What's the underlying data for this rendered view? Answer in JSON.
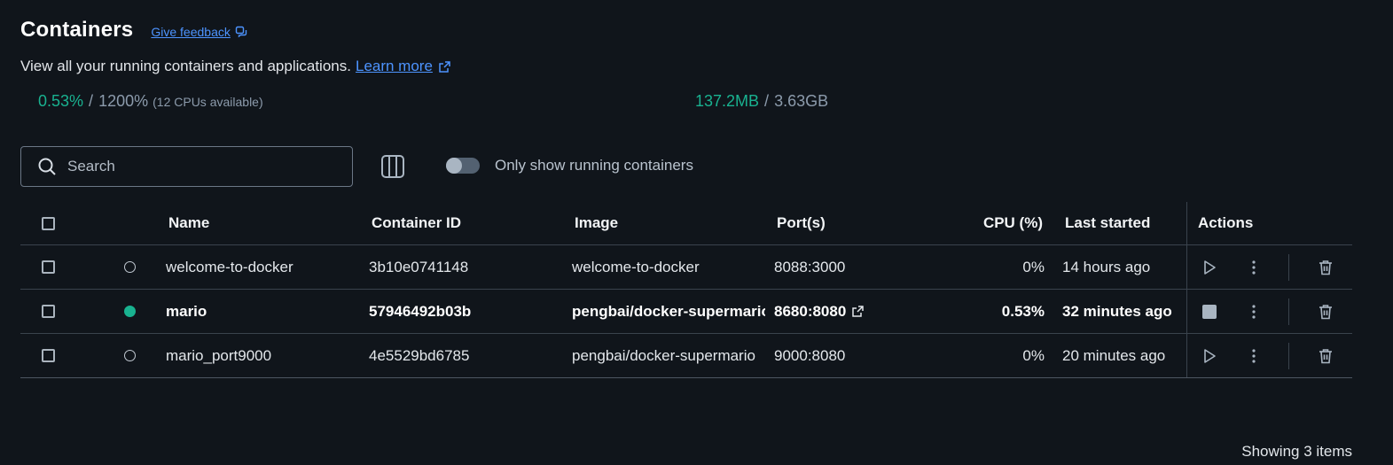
{
  "header": {
    "title": "Containers",
    "feedback": "Give feedback",
    "description": "View all your running containers and applications.",
    "learn_more": "Learn more"
  },
  "stats": {
    "cpu_used": "0.53%",
    "cpu_sep": "/",
    "cpu_total": "1200%",
    "cpu_note": "(12 CPUs available)",
    "mem_used": "137.2MB",
    "mem_sep": "/",
    "mem_total": "3.63GB"
  },
  "toolbar": {
    "search_placeholder": "Search",
    "toggle_label": "Only show running containers",
    "toggle_on": false
  },
  "table": {
    "columns": {
      "name": "Name",
      "container_id": "Container ID",
      "image": "Image",
      "ports": "Port(s)",
      "cpu": "CPU (%)",
      "last_started": "Last started",
      "actions": "Actions"
    },
    "rows": [
      {
        "name": "welcome-to-docker",
        "container_id": "3b10e0741148",
        "image": "welcome-to-docker",
        "ports": "8088:3000",
        "cpu": "0%",
        "last_started": "14 hours ago",
        "status": "stopped"
      },
      {
        "name": "mario",
        "container_id": "57946492b03b",
        "image": "pengbai/docker-supermario",
        "ports": "8680:8080",
        "cpu": "0.53%",
        "last_started": "32 minutes ago",
        "status": "running"
      },
      {
        "name": "mario_port9000",
        "container_id": "4e5529bd6785",
        "image": "pengbai/docker-supermario",
        "ports": "9000:8080",
        "cpu": "0%",
        "last_started": "20 minutes ago",
        "status": "stopped"
      }
    ]
  },
  "footer": {
    "count_text": "Showing 3 items"
  },
  "colors": {
    "background": "#10151b",
    "accent_green": "#19b290",
    "link_blue": "#4d94ff"
  },
  "icons": [
    "external-link-icon",
    "feedback-icon",
    "search-icon",
    "columns-icon",
    "play-icon",
    "stop-icon",
    "more-vertical-icon",
    "trash-icon"
  ]
}
